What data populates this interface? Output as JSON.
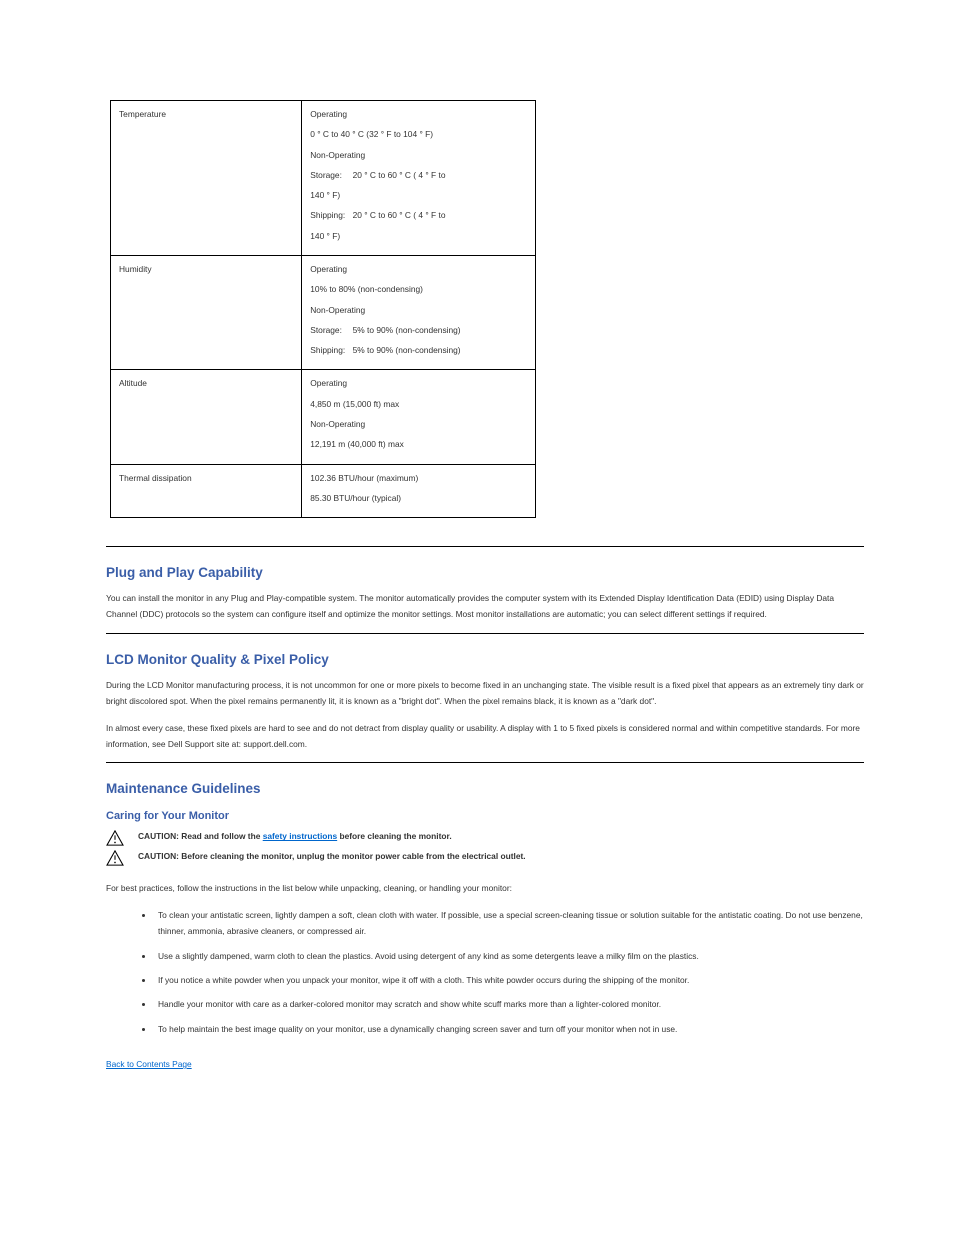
{
  "table": {
    "rows": [
      {
        "key": "Temperature",
        "val": {
          "op_label": "Operating",
          "op_val": "0 ° C to 40 ° C (32 ° F to 104 ° F)",
          "non_label": "Non-Operating",
          "stor_label": "Storage:",
          "stor_val": "20 ° C to 60 ° C ( 4 ° F to",
          "stor_val2": "140 ° F)",
          "ship_label": "Shipping:",
          "ship_val": "20 ° C to 60 ° C ( 4 ° F to",
          "ship_val2": "140 ° F)"
        }
      },
      {
        "key": "Humidity",
        "val": {
          "op_label": "Operating",
          "op_val": "10% to 80% (non-condensing)",
          "non_label": "Non-Operating",
          "stor_label": "Storage:",
          "stor_val": "5% to 90% (non-condensing)",
          "ship_label": "Shipping:",
          "ship_val": "5% to 90% (non-condensing)"
        }
      },
      {
        "key": "Altitude",
        "val": {
          "op_label": "Operating",
          "op_val": "4,850 m (15,000 ft) max",
          "non_label": "Non-Operating",
          "non_val": "12,191 m (40,000 ft) max"
        }
      },
      {
        "key": "Thermal dissipation",
        "val_lines": [
          "102.36 BTU/hour (maximum)",
          "85.30 BTU/hour (typical)"
        ]
      }
    ]
  },
  "pnp": {
    "heading": "Plug and Play Capability",
    "body": "You can install the monitor in any Plug and Play-compatible system. The monitor automatically provides the computer system with its Extended Display Identification Data (EDID) using Display Data Channel (DDC) protocols so the system can configure itself and optimize the monitor settings. Most monitor installations are automatic; you can select different settings if required."
  },
  "quality": {
    "heading": "LCD Monitor Quality & Pixel Policy",
    "body": "During the LCD Monitor manufacturing process, it is not uncommon for one or more pixels to become fixed in an unchanging state. The visible result is a fixed pixel that appears as an extremely tiny dark or bright discolored spot. When the pixel remains permanently lit, it is known as a \"bright dot\". When the pixel remains black, it is known as a \"dark dot\".",
    "body2": "In almost every case, these fixed pixels are hard to see and do not detract from display quality or usability. A display with 1 to 5 fixed pixels is considered normal and within competitive standards.  For more information, see Dell Support site at: support.dell.com."
  },
  "maint": {
    "heading": "Maintenance Guidelines",
    "sub": "Caring for Your Monitor",
    "caution1_prefix": "CAUTION: Read and follow the ",
    "caution1_link": "safety instructions",
    "caution1_suffix": " before cleaning the monitor.",
    "caution2": "CAUTION:  Before cleaning the monitor, unplug the monitor power cable from the electrical outlet.",
    "lead": "For best practices, follow the instructions in the list below while unpacking, cleaning, or handling your monitor:",
    "bullets": [
      "To clean your antistatic screen, lightly dampen a soft, clean cloth with water. If possible, use a special screen-cleaning tissue or solution suitable for the antistatic coating. Do not use benzene, thinner, ammonia, abrasive cleaners, or compressed air.",
      "Use a slightly dampened, warm cloth to clean the plastics. Avoid using detergent of any kind as some detergents leave a milky film on the plastics.",
      "If you notice a white powder when you unpack your monitor, wipe it off with a cloth. This white powder occurs during the shipping of the monitor.",
      "Handle your monitor with care as a darker-colored monitor may scratch and show white scuff marks more than a lighter-colored monitor.",
      "To help maintain the best image quality on your monitor, use a dynamically changing screen saver and turn off your monitor when not in use."
    ]
  },
  "footer_link": "Back to Contents Page"
}
